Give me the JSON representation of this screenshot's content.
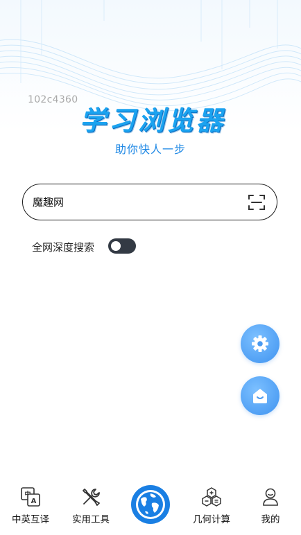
{
  "debug_id": "102c4360",
  "brand": {
    "title": "学习浏览器",
    "slogan": "助你快人一步"
  },
  "search": {
    "value": "魔趣网",
    "placeholder": ""
  },
  "deep_search": {
    "label": "全网深度搜索",
    "enabled": true
  },
  "fabs": [
    {
      "name": "settings",
      "icon": "gear-icon"
    },
    {
      "name": "home",
      "icon": "home-face-icon"
    }
  ],
  "nav": {
    "translate": "中英互译",
    "tools": "实用工具",
    "geometry": "几何计算",
    "mine": "我的"
  },
  "colors": {
    "accent": "#1a7fe3",
    "brand": "#1ba3f0",
    "fab": "#4a9af0",
    "toggle": "#333a44"
  }
}
